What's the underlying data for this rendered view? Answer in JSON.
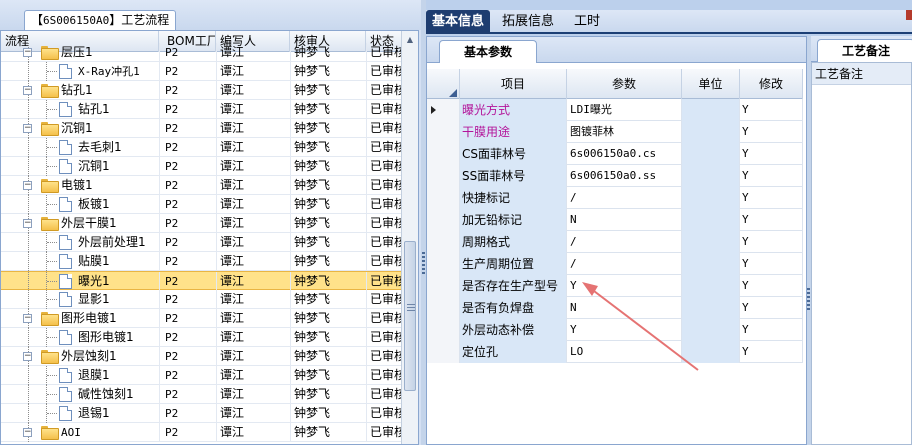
{
  "left_panel": {
    "tab_code": "6S006150A0",
    "tab_prefix": "【",
    "tab_suffix": "】工艺流程",
    "columns": [
      "流程",
      "BOM工厂",
      "编写人",
      "核审人",
      "状态"
    ],
    "rows": [
      {
        "name": "层压1",
        "bom": "P2",
        "writer": "谭江",
        "reviewer": "钟梦飞",
        "status": "已审核",
        "level": 1,
        "type": "folder"
      },
      {
        "name": "X-Ray冲孔1",
        "bom": "P2",
        "writer": "谭江",
        "reviewer": "钟梦飞",
        "status": "已审核",
        "level": 2,
        "type": "doc"
      },
      {
        "name": "钻孔1",
        "bom": "P2",
        "writer": "谭江",
        "reviewer": "钟梦飞",
        "status": "已审核",
        "level": 1,
        "type": "folder"
      },
      {
        "name": "钻孔1",
        "bom": "P2",
        "writer": "谭江",
        "reviewer": "钟梦飞",
        "status": "已审核",
        "level": 2,
        "type": "doc"
      },
      {
        "name": "沉铜1",
        "bom": "P2",
        "writer": "谭江",
        "reviewer": "钟梦飞",
        "status": "已审核",
        "level": 1,
        "type": "folder"
      },
      {
        "name": "去毛刺1",
        "bom": "P2",
        "writer": "谭江",
        "reviewer": "钟梦飞",
        "status": "已审核",
        "level": 2,
        "type": "doc"
      },
      {
        "name": "沉铜1",
        "bom": "P2",
        "writer": "谭江",
        "reviewer": "钟梦飞",
        "status": "已审核",
        "level": 2,
        "type": "doc"
      },
      {
        "name": "电镀1",
        "bom": "P2",
        "writer": "谭江",
        "reviewer": "钟梦飞",
        "status": "已审核",
        "level": 1,
        "type": "folder"
      },
      {
        "name": "板镀1",
        "bom": "P2",
        "writer": "谭江",
        "reviewer": "钟梦飞",
        "status": "已审核",
        "level": 2,
        "type": "doc"
      },
      {
        "name": "外层干膜1",
        "bom": "P2",
        "writer": "谭江",
        "reviewer": "钟梦飞",
        "status": "已审核",
        "level": 1,
        "type": "folder"
      },
      {
        "name": "外层前处理1",
        "bom": "P2",
        "writer": "谭江",
        "reviewer": "钟梦飞",
        "status": "已审核",
        "level": 2,
        "type": "doc"
      },
      {
        "name": "贴膜1",
        "bom": "P2",
        "writer": "谭江",
        "reviewer": "钟梦飞",
        "status": "已审核",
        "level": 2,
        "type": "doc"
      },
      {
        "name": "曝光1",
        "bom": "P2",
        "writer": "谭江",
        "reviewer": "钟梦飞",
        "status": "已审核",
        "level": 2,
        "type": "doc",
        "selected": true
      },
      {
        "name": "显影1",
        "bom": "P2",
        "writer": "谭江",
        "reviewer": "钟梦飞",
        "status": "已审核",
        "level": 2,
        "type": "doc"
      },
      {
        "name": "图形电镀1",
        "bom": "P2",
        "writer": "谭江",
        "reviewer": "钟梦飞",
        "status": "已审核",
        "level": 1,
        "type": "folder"
      },
      {
        "name": "图形电镀1",
        "bom": "P2",
        "writer": "谭江",
        "reviewer": "钟梦飞",
        "status": "已审核",
        "level": 2,
        "type": "doc"
      },
      {
        "name": "外层蚀刻1",
        "bom": "P2",
        "writer": "谭江",
        "reviewer": "钟梦飞",
        "status": "已审核",
        "level": 1,
        "type": "folder"
      },
      {
        "name": "退膜1",
        "bom": "P2",
        "writer": "谭江",
        "reviewer": "钟梦飞",
        "status": "已审核",
        "level": 2,
        "type": "doc"
      },
      {
        "name": "碱性蚀刻1",
        "bom": "P2",
        "writer": "谭江",
        "reviewer": "钟梦飞",
        "status": "已审核",
        "level": 2,
        "type": "doc"
      },
      {
        "name": "退锡1",
        "bom": "P2",
        "writer": "谭江",
        "reviewer": "钟梦飞",
        "status": "已审核",
        "level": 2,
        "type": "doc"
      },
      {
        "name": "AOI",
        "bom": "P2",
        "writer": "谭江",
        "reviewer": "钟梦飞",
        "status": "已审核",
        "level": 1,
        "type": "folder"
      }
    ]
  },
  "top_tabs": [
    "基本信息",
    "拓展信息",
    "工时"
  ],
  "params_panel": {
    "tab": "基本参数",
    "columns": [
      "项目",
      "参数",
      "单位",
      "修改"
    ],
    "rows": [
      {
        "item": "曝光方式",
        "param": "LDI曝光",
        "unit": "",
        "mod": "Y",
        "highlight": true,
        "current": true
      },
      {
        "item": "干膜用途",
        "param": "图镀菲林",
        "unit": "",
        "mod": "Y",
        "highlight": true
      },
      {
        "item": "CS面菲林号",
        "param": "6s006150a0.cs",
        "unit": "",
        "mod": "Y"
      },
      {
        "item": "SS面菲林号",
        "param": "6s006150a0.ss",
        "unit": "",
        "mod": "Y"
      },
      {
        "item": "快捷标记",
        "param": "/",
        "unit": "",
        "mod": "Y"
      },
      {
        "item": "加无铅标记",
        "param": "N",
        "unit": "",
        "mod": "Y"
      },
      {
        "item": "周期格式",
        "param": "/",
        "unit": "",
        "mod": "Y"
      },
      {
        "item": "生产周期位置",
        "param": "/",
        "unit": "",
        "mod": "Y"
      },
      {
        "item": "是否存在生产型号",
        "param": "Y",
        "unit": "",
        "mod": "Y"
      },
      {
        "item": "是否有负焊盘",
        "param": "N",
        "unit": "",
        "mod": "Y"
      },
      {
        "item": "外层动态补偿",
        "param": "Y",
        "unit": "",
        "mod": "Y"
      },
      {
        "item": "定位孔",
        "param": "LO",
        "unit": "",
        "mod": "Y"
      }
    ]
  },
  "remarks_panel": {
    "tab": "工艺备注",
    "label": "工艺备注"
  },
  "colors": {
    "active_tab": "#1e3d70",
    "selected_row": "#ffe28a",
    "highlight_text": "#b3149a",
    "annotation_arrow": "#e57373"
  }
}
